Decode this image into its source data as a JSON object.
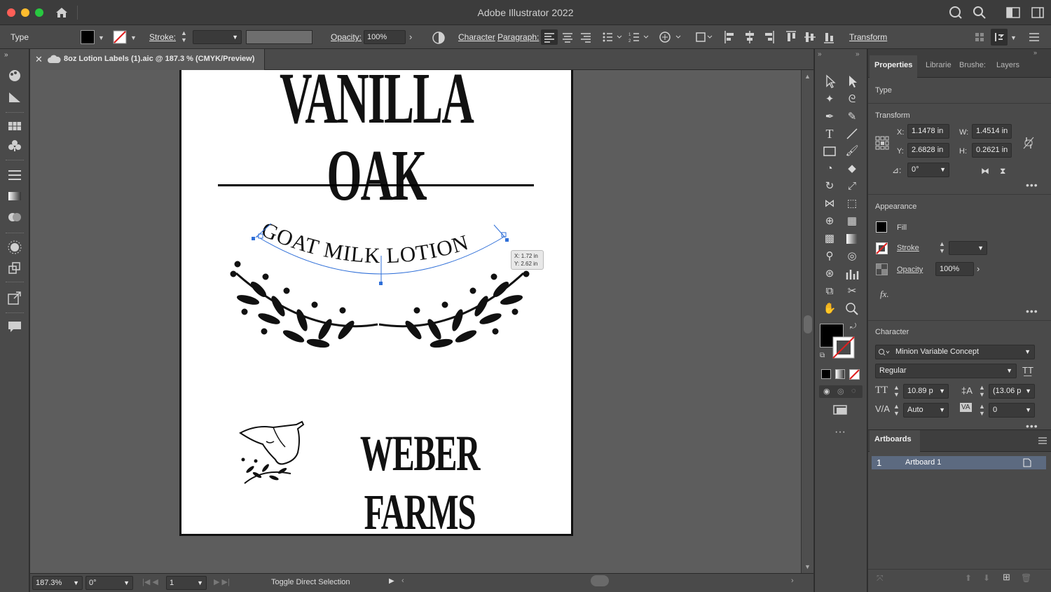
{
  "app": {
    "title": "Adobe Illustrator 2022"
  },
  "control_bar": {
    "mode_label": "Type",
    "stroke_label": "Stroke:",
    "opacity_label": "Opacity:",
    "opacity_value": "100%",
    "character_link": "Character",
    "paragraph_link": "Paragraph:",
    "transform_link": "Transform"
  },
  "document": {
    "tab_title": "8oz Lotion Labels (1).aic @ 187.3 % (CMYK/Preview)"
  },
  "artboard_content": {
    "headline": "VANILLA OAK",
    "curved_text": "GOAT MILK LOTION",
    "brand": "WEBER FARMS",
    "tooltip_x": "X: 1.72 in",
    "tooltip_y": "Y: 2.62 in"
  },
  "status_bar": {
    "zoom": "187.3%",
    "rotation": "0°",
    "artboard_number": "1",
    "status_text": "Toggle Direct Selection"
  },
  "panel": {
    "tabs": [
      "Properties",
      "Librarie",
      "Brushe:",
      "Layers"
    ],
    "type_section": "Type",
    "transform": {
      "title": "Transform",
      "x_label": "X:",
      "x_value": "1.1478 in",
      "y_label": "Y:",
      "y_value": "2.6828 in",
      "w_label": "W:",
      "w_value": "1.4514 in",
      "h_label": "H:",
      "h_value": "0.2621 in",
      "angle_value": "0°"
    },
    "appearance": {
      "title": "Appearance",
      "fill_label": "Fill",
      "stroke_label": "Stroke",
      "opacity_label": "Opacity",
      "opacity_value": "100%"
    },
    "character": {
      "title": "Character",
      "font_family": "Minion Variable Concept",
      "font_style": "Regular",
      "font_size": "10.89 p",
      "leading": "(13.06 p",
      "kerning": "Auto",
      "tracking": "0"
    },
    "artboards": {
      "title": "Artboards",
      "items": [
        {
          "number": "1",
          "name": "Artboard 1"
        }
      ]
    }
  },
  "colors": {
    "accent": "#4a90e2",
    "selection": "#2f6fd8",
    "panel_bg": "#4a4a4a",
    "canvas_bg": "#5d5d5d"
  }
}
